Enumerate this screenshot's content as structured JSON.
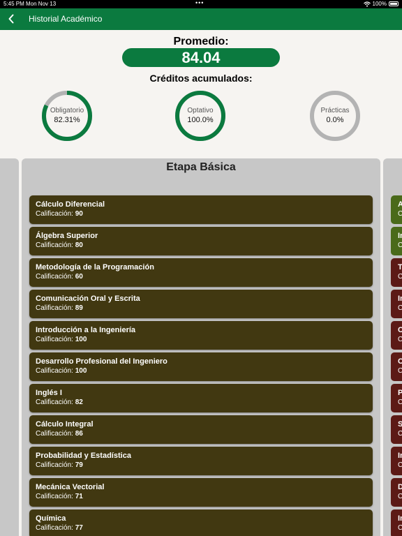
{
  "status_bar": {
    "time": "5:45 PM  Mon Nov 13",
    "dots": "•••",
    "battery_pct": "100%"
  },
  "nav": {
    "title": "Historial Académico"
  },
  "summary": {
    "promedio_label": "Promedio:",
    "promedio_value": "84.04",
    "creditos_label": "Créditos acumulados:",
    "rings": [
      {
        "label": "Obligatorio",
        "value": "82.31%",
        "fraction": 0.8231,
        "color": "#0b7a3f"
      },
      {
        "label": "Optativo",
        "value": "100.0%",
        "fraction": 1.0,
        "color": "#0b7a3f"
      },
      {
        "label": "Prácticas",
        "value": "0.0%",
        "fraction": 0.0,
        "color": "#0b7a3f"
      }
    ],
    "ring_track_color": "#b3b3b3"
  },
  "stage": {
    "title": "Etapa Básica",
    "grade_prefix": "Calificación: ",
    "card_color": "#413811",
    "courses": [
      {
        "name": "Cálculo Diferencial",
        "grade": "90"
      },
      {
        "name": "Álgebra Superior",
        "grade": "80"
      },
      {
        "name": "Metodología de la Programación",
        "grade": "60"
      },
      {
        "name": "Comunicación Oral y Escrita",
        "grade": "89"
      },
      {
        "name": "Introducción a la Ingeniería",
        "grade": "100"
      },
      {
        "name": "Desarrollo Profesional del Ingeniero",
        "grade": "100"
      },
      {
        "name": "Inglés I",
        "grade": "82"
      },
      {
        "name": "Cálculo Integral",
        "grade": "86"
      },
      {
        "name": "Probabilidad y Estadística",
        "grade": "79"
      },
      {
        "name": "Mecánica Vectorial",
        "grade": "71"
      },
      {
        "name": "Química",
        "grade": "77"
      }
    ]
  },
  "next_stage_peek": [
    {
      "l1": "A",
      "l2": "C",
      "color": "#4a6a1a"
    },
    {
      "l1": "In",
      "l2": "C",
      "color": "#4a6a1a"
    },
    {
      "l1": "T",
      "l2": "C",
      "color": "#5c1a16"
    },
    {
      "l1": "In",
      "l2": "C",
      "color": "#5c1a16"
    },
    {
      "l1": "C",
      "l2": "C",
      "color": "#5c1a16"
    },
    {
      "l1": "C",
      "l2": "C",
      "color": "#5c1a16"
    },
    {
      "l1": "P",
      "l2": "C",
      "color": "#5c1a16"
    },
    {
      "l1": "S",
      "l2": "C",
      "color": "#5c1a16"
    },
    {
      "l1": "In",
      "l2": "C",
      "color": "#5c1a16"
    },
    {
      "l1": "D",
      "l2": "C",
      "color": "#5c1a16"
    },
    {
      "l1": "In",
      "l2": "C",
      "color": "#5c1a16"
    }
  ]
}
